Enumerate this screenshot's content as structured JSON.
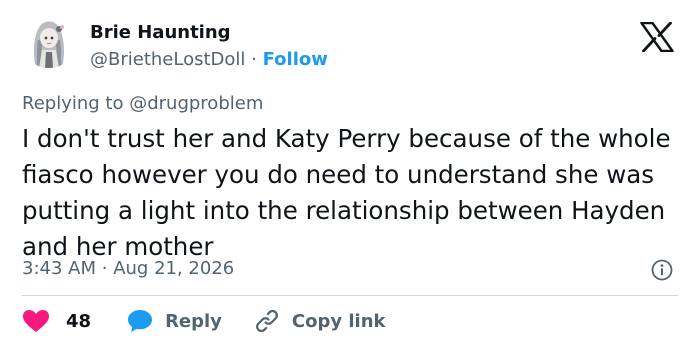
{
  "author": {
    "name": "Brie Haunting",
    "handle": "@BrietheLostDoll",
    "separator": "·",
    "follow_label": "Follow"
  },
  "reply_context": {
    "prefix": "Replying to",
    "mention": "@drugproblem"
  },
  "tweet": {
    "text": "I don't trust her and Katy Perry because of the whole fiasco however you do need to understand she was putting a light into the relationship between Hayden and her mother",
    "time": "3:43 AM",
    "time_separator": "·",
    "date": "Aug 21, 2026"
  },
  "actions": {
    "like_count": "48",
    "reply_label": "Reply",
    "copy_label": "Copy link"
  },
  "icons": {
    "logo": "x-logo-icon",
    "info": "info-icon",
    "like": "heart-icon",
    "reply": "speech-bubble-icon",
    "copy": "link-icon"
  },
  "colors": {
    "follow": "#1d9bf0",
    "heart": "#f91880",
    "reply_bubble": "#1d9bf0",
    "secondary_text": "#536471",
    "primary_text": "#0f1419"
  }
}
